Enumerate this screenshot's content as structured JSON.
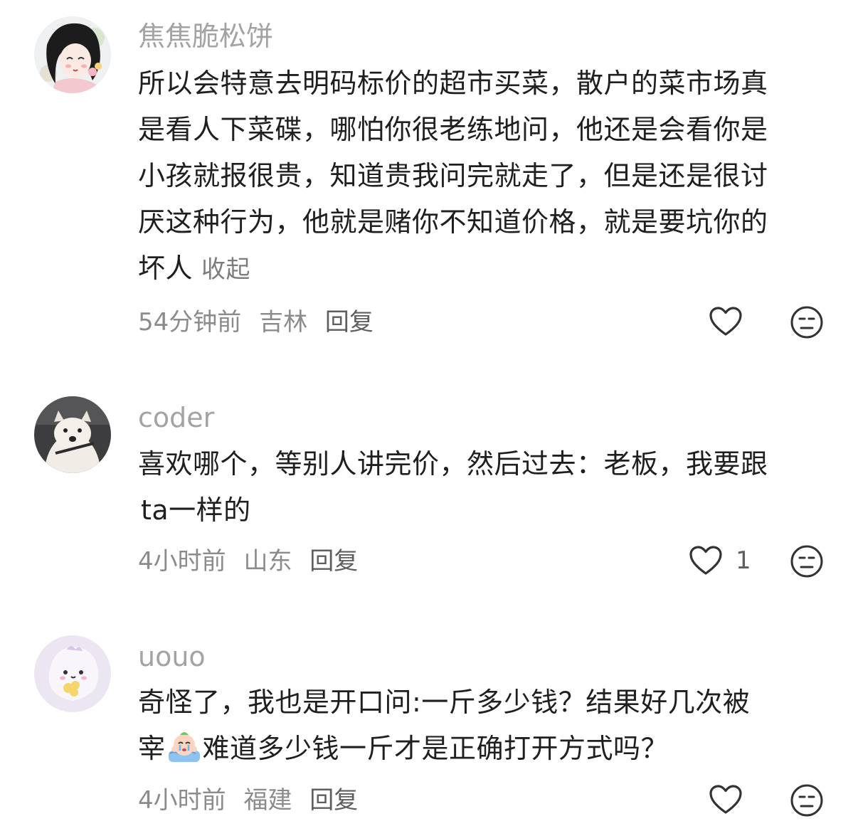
{
  "comments": [
    {
      "username": "焦焦脆松饼",
      "text_lines": [
        "所以会特意去明码标价的超市买菜，散户的菜市场真",
        "是看人下菜碟，哪怕你很老练地问，他还是会看你是",
        "小孩就报很贵，知道贵我问完就走了，但是还是很讨",
        "厌这种行为，他就是赌你不知道价格，就是要坑你的",
        "坏人"
      ],
      "collapse_label": "收起",
      "time": "54分钟前",
      "location": "吉林",
      "reply_label": "回复",
      "like_icon": "heart-outline-icon",
      "dislike_icon": "neutral-face-icon"
    },
    {
      "username": "coder",
      "text_lines": [
        "喜欢哪个，等别人讲完价，然后过去：老板，我要跟",
        "ta一样的"
      ],
      "time": "4小时前",
      "location": "山东",
      "reply_label": "回复",
      "like_count": "1",
      "like_icon": "heart-outline-icon",
      "dislike_icon": "neutral-face-icon"
    },
    {
      "username": "uouo",
      "text_line_1": "奇怪了，我也是开口问:一斤多少钱？结果好几次被",
      "text_line_2_before": "宰",
      "text_line_2_emoji": "crying-peach-emoji",
      "text_line_2_after": "难道多少钱一斤才是正确打开方式吗？",
      "time": "4小时前",
      "location": "福建",
      "reply_label": "回复",
      "like_icon": "heart-outline-icon",
      "dislike_icon": "neutral-face-icon"
    }
  ],
  "colors": {
    "username": "#a3a3a3",
    "body": "#1f1f1f",
    "meta": "#8b8b8b",
    "icon_stroke": "#333333"
  }
}
